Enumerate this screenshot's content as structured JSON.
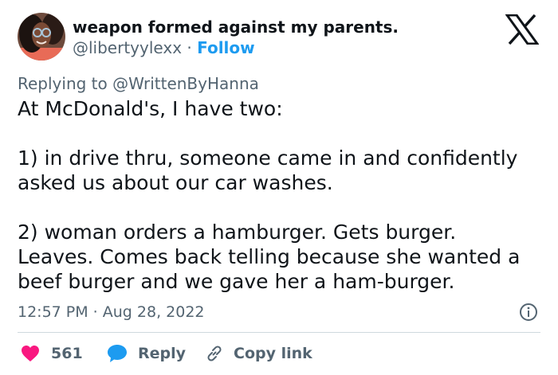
{
  "author": {
    "display_name": "weapon formed against my parents.",
    "handle": "@libertyylexx",
    "separator": " · ",
    "follow_label": "Follow"
  },
  "reply_context": {
    "text": "Replying to @WrittenByHanna"
  },
  "tweet": {
    "lines": [
      "At McDonald's, I have two:",
      "1) in drive thru, someone came in and confidently",
      "asked us about our car washes.",
      "2) woman orders a hamburger. Gets burger.",
      "Leaves. Comes back telling because she wanted a",
      "beef burger and we gave her a ham-burger."
    ],
    "timestamp": "12:57 PM · Aug 28, 2022"
  },
  "actions": {
    "like_count": "561",
    "reply_label": "Reply",
    "copy_link_label": "Copy link"
  },
  "icons": {
    "logo": "x-logo-icon",
    "like": "heart-icon",
    "reply": "speech-bubble-icon",
    "copy": "link-icon",
    "info": "info-icon"
  },
  "colors": {
    "accent": "#1d9bf0",
    "like": "#f91880",
    "secondary_text": "#536471",
    "primary_text": "#0f1419"
  }
}
